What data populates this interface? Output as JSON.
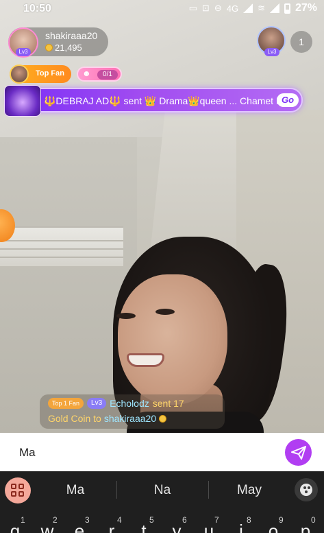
{
  "status_bar": {
    "time": "10:50",
    "network_label": "4G",
    "battery": "27%"
  },
  "host": {
    "name": "shakiraaa20",
    "coins": "21,495",
    "level": "Lv3"
  },
  "viewer": {
    "level": "Lv3",
    "count": "1"
  },
  "top_fan": {
    "label": "Top Fan"
  },
  "task": {
    "progress": "0/1"
  },
  "banner": {
    "text": "🔱DEBRAJ AD🔱 sent 👑 Drama👑queen ... Chamet No",
    "go_label": "Go"
  },
  "gift_message": {
    "fan_badge": "Top 1 Fan",
    "level_badge": "Lv3",
    "sender": "Echolodz",
    "verb": "sent 17",
    "coin_label": "Gold Coin to",
    "recipient": "shakiraaa20"
  },
  "chat_input": {
    "value": "Ma"
  },
  "keyboard": {
    "suggestions": [
      "Ma",
      "Na",
      "May"
    ],
    "keys": [
      {
        "num": "1",
        "letter": "q"
      },
      {
        "num": "2",
        "letter": "w"
      },
      {
        "num": "3",
        "letter": "e"
      },
      {
        "num": "4",
        "letter": "r"
      },
      {
        "num": "5",
        "letter": "t"
      },
      {
        "num": "6",
        "letter": "y"
      },
      {
        "num": "7",
        "letter": "u"
      },
      {
        "num": "8",
        "letter": "i"
      },
      {
        "num": "9",
        "letter": "o"
      },
      {
        "num": "0",
        "letter": "p"
      }
    ]
  },
  "colors": {
    "send_button": "#b13ef2",
    "banner": "#7b2ff7",
    "top_fan": "#ffb01f"
  }
}
